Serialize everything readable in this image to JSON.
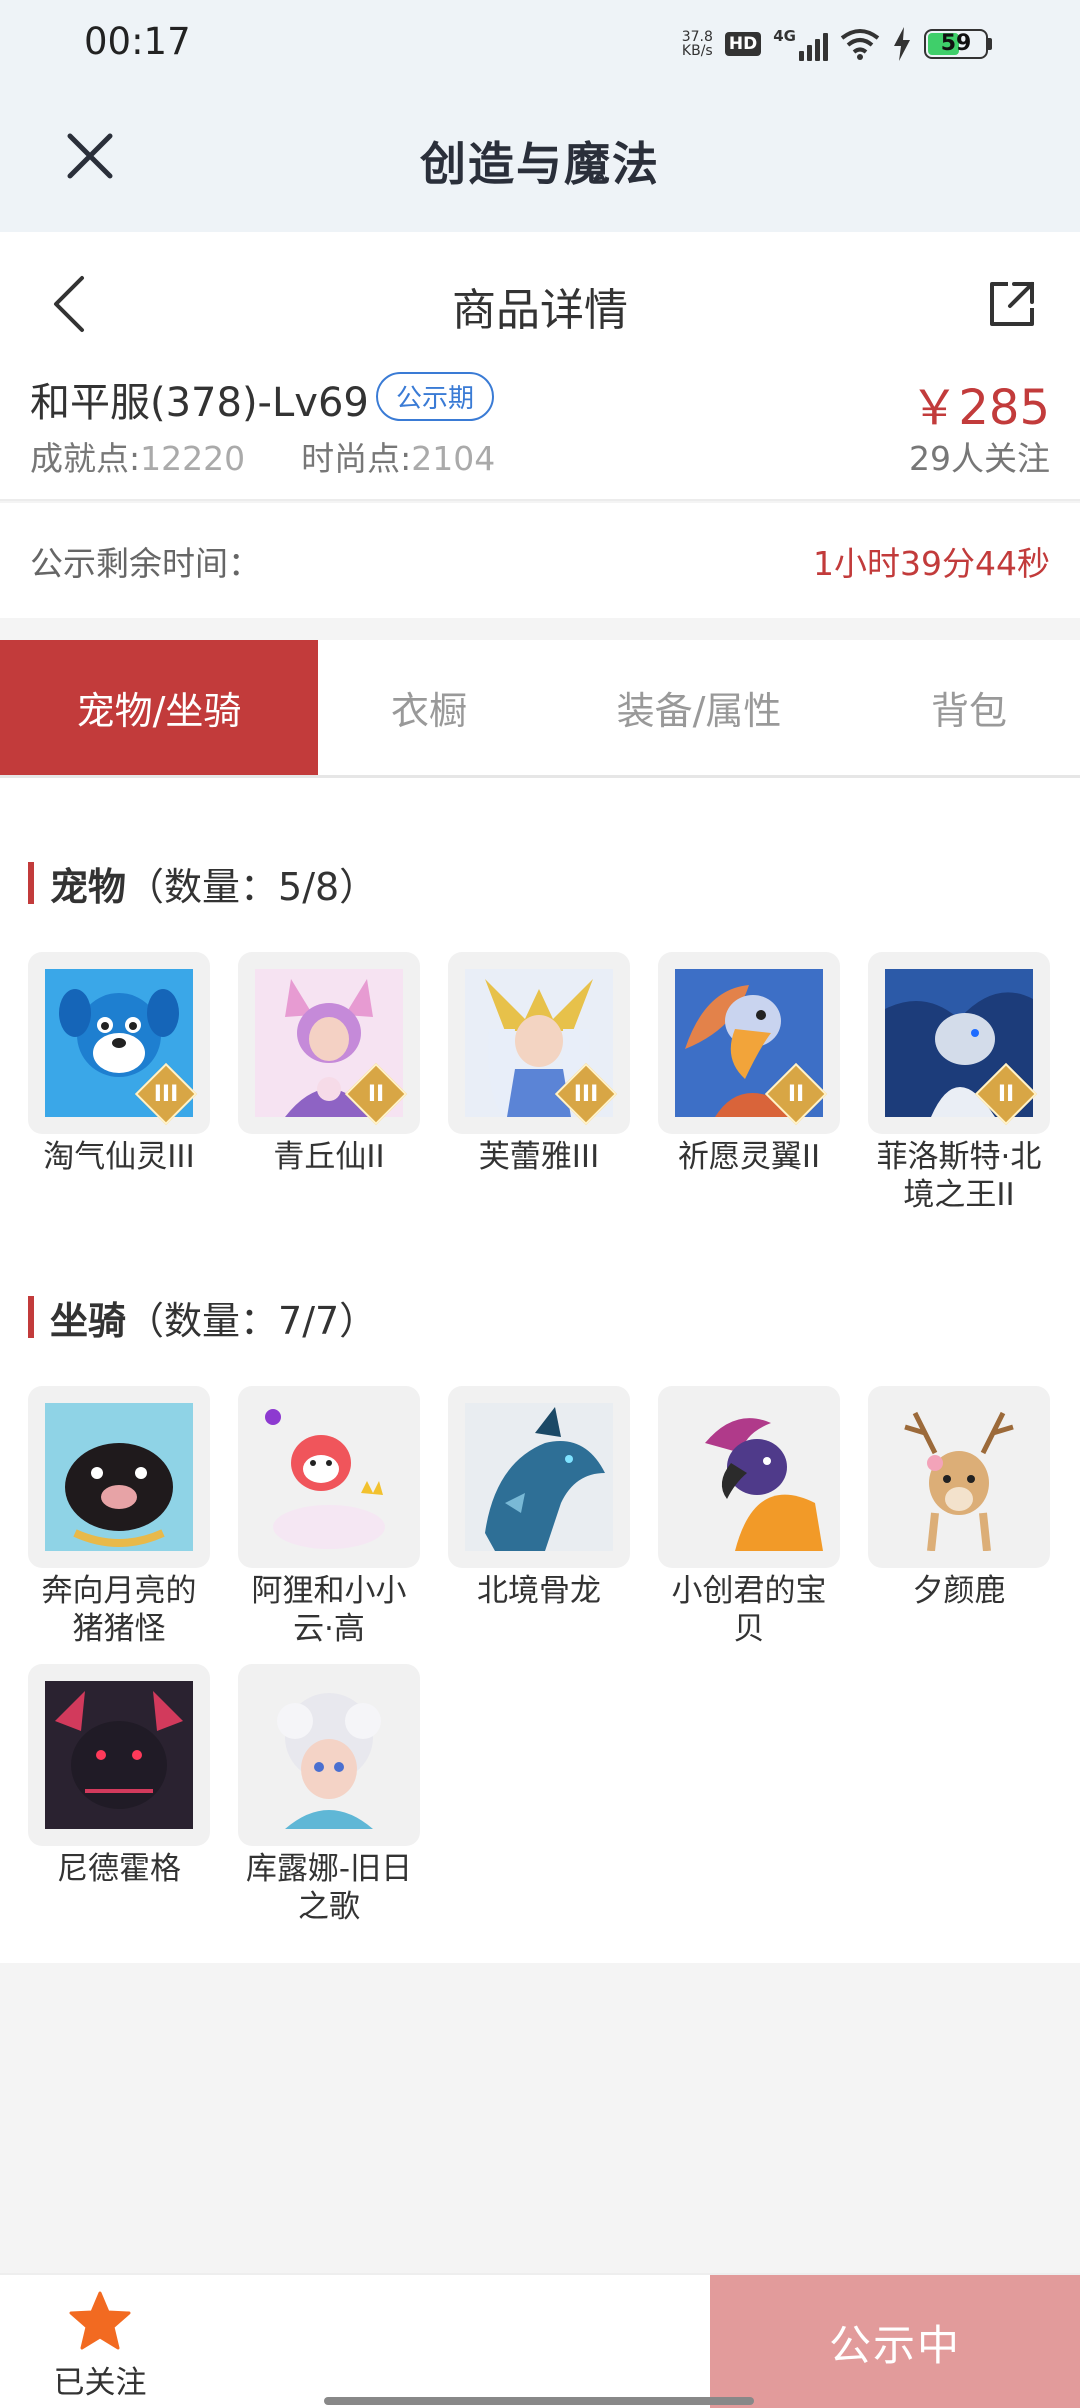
{
  "status_bar": {
    "time": "00:17",
    "net_speed_value": "37.8",
    "net_speed_unit": "KB/s",
    "hd": "HD",
    "network": "4G",
    "battery": "59"
  },
  "app_header": {
    "title": "创造与魔法",
    "close_icon": "close-icon"
  },
  "detail_nav": {
    "title": "商品详情",
    "back_icon": "chevron-left-icon",
    "share_icon": "share-icon"
  },
  "listing": {
    "server": "和平服(378)-Lv69",
    "badge": "公示期",
    "achievement_label": "成就点:",
    "achievement_value": "12220",
    "fashion_label": "时尚点:",
    "fashion_value": "2104",
    "price": "￥285",
    "followers": "29人关注"
  },
  "countdown": {
    "label": "公示剩余时间：",
    "value": "1小时39分44秒"
  },
  "tabs": [
    {
      "label": "宠物/坐骑",
      "active": true
    },
    {
      "label": "衣橱",
      "active": false
    },
    {
      "label": "装备/属性",
      "active": false
    },
    {
      "label": "背包",
      "active": false
    }
  ],
  "pets": {
    "title": "宠物",
    "count": "（数量：5/8）",
    "items": [
      {
        "name": "淘气仙灵III",
        "tier": "III"
      },
      {
        "name": "青丘仙II",
        "tier": "II"
      },
      {
        "name": "芙蕾雅III",
        "tier": "III"
      },
      {
        "name": "祈愿灵翼II",
        "tier": "II"
      },
      {
        "name": "菲洛斯特·北境之王II",
        "tier": "II"
      }
    ]
  },
  "mounts": {
    "title": "坐骑",
    "count": "（数量：7/7）",
    "items": [
      {
        "name": "奔向月亮的猪猪怪"
      },
      {
        "name": "阿狸和小小云·高"
      },
      {
        "name": "北境骨龙"
      },
      {
        "name": "小创君的宝贝"
      },
      {
        "name": "夕颜鹿"
      },
      {
        "name": "尼德霍格"
      },
      {
        "name": "库露娜-旧日之歌"
      }
    ]
  },
  "bottom_bar": {
    "follow_label": "已关注",
    "status_button": "公示中"
  },
  "colors": {
    "accent_red": "#c23b3b",
    "badge_blue": "#3a7bd5",
    "disabled_button": "#e29b9b",
    "star_orange": "#f26a21"
  }
}
